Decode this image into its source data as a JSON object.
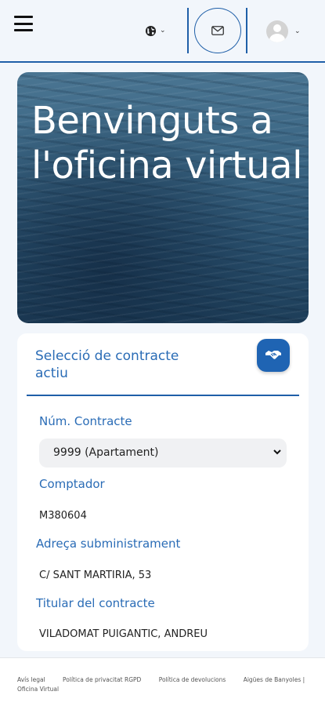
{
  "header": {
    "menu_icon": "hamburger-menu-icon",
    "language_icon": "globe-icon",
    "mail_icon": "envelope-icon",
    "user_icon": "user-avatar-icon",
    "accent_color": "#1f5fa8"
  },
  "hero": {
    "title": "Benvinguts a l'oficina virtual"
  },
  "contract_card": {
    "title": "Selecció de contracte actiu",
    "switch_icon": "handshake-icon",
    "contract_number_label": "Núm. Contracte",
    "contract_select_value": "9999 (Apartament)",
    "meter_label": "Comptador",
    "meter_value": "M380604",
    "address_label": "Adreça subministrament",
    "address_value": "C/ SANT MARTIRIA, 53",
    "holder_label": "Titular del contracte",
    "holder_value": "VILADOMAT PUIGANTIC, ANDREU"
  },
  "footer": {
    "links": [
      "Avís legal",
      "Política de privacitat RGPD",
      "Política de devolucions",
      "Aigües de Banyoles | Oficina Virtual"
    ]
  }
}
